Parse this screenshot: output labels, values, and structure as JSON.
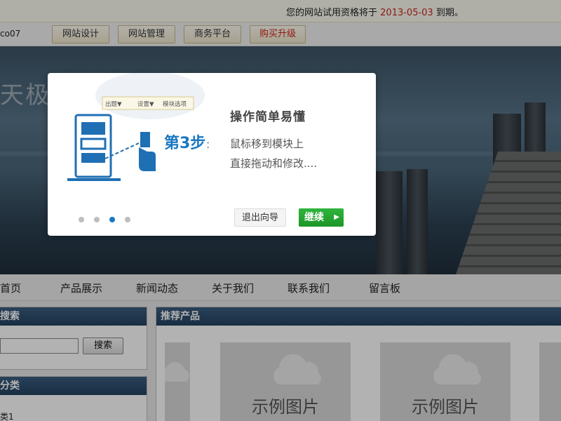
{
  "notice": {
    "prefix": "您的网站试用资格将于",
    "date": "2013-05-03",
    "suffix": "到期。"
  },
  "toolbar": {
    "username": "co07",
    "buttons": [
      "网站设计",
      "网站管理",
      "商务平台",
      "购买升级"
    ]
  },
  "banner": {
    "logo": "天极"
  },
  "nav": {
    "items": [
      "首页",
      "产品展示",
      "新闻动态",
      "关于我们",
      "联系我们",
      "留言板"
    ]
  },
  "sidebar": {
    "search_title": "搜索",
    "search_value": "",
    "search_button": "搜索",
    "category_title": "分类",
    "category_item": "类1"
  },
  "products": {
    "title": "推荐产品",
    "placeholder_label": "示例图片"
  },
  "wizard": {
    "toolbar_items": [
      "出题▼",
      "设置▼",
      "模块选项"
    ],
    "step_label": "第3步",
    "step_colon": "：",
    "title": "操作简单易懂",
    "lines": [
      "鼠标移到模块上",
      "直接拖动和修改...."
    ],
    "exit_label": "退出向导",
    "continue_label": "继续",
    "dot_count": 4,
    "active_step": 3
  },
  "colors": {
    "accent": "#1a78c2",
    "continue": "#22a22e",
    "warning_date": "#c8271a",
    "panel_header": "#2f5070"
  }
}
